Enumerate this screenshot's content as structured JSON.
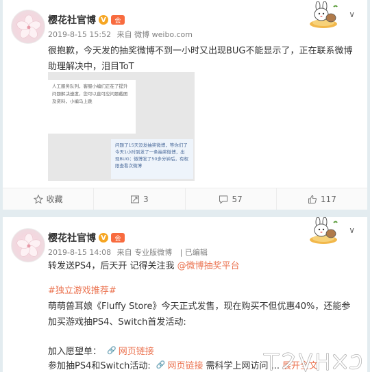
{
  "post1": {
    "author": "樱花社官博",
    "verified_badge": "V",
    "member_badge": "会",
    "date": "2019-8-15 15:52",
    "source_prefix": "来自",
    "source": "微博 weibo.com",
    "text": "很抱歉，今天发的抽奖微博不到一小时又出现BUG不能显示了，正在联系微博助理解决中，泪目ToT",
    "image": {
      "chat_left": "人工服务队列，客服小编们正在了提升问题解决速度，您可以直可应问题截图及资料，小编马上跳",
      "chat_right": "问题了15天没发抽奖微博，等你们了今天1小时到发了一条抽奖微博，出现BUG：微博发了50多分钟后，有权限查看次微博"
    },
    "actions": [
      {
        "icon": "star-icon",
        "label": "收藏"
      },
      {
        "icon": "repost-icon",
        "label": "3"
      },
      {
        "icon": "comment-icon",
        "label": "57"
      },
      {
        "icon": "thumbs-up-icon",
        "label": "117"
      }
    ]
  },
  "post2": {
    "author": "樱花社官博",
    "verified_badge": "V",
    "member_badge": "会",
    "date": "2019-8-15 14:08",
    "source_prefix": "来自",
    "source": "专业版微博",
    "edited": "已编辑",
    "line1_text": "转发送PS4，后天开 记得关注我 ",
    "line1_link": "@微博抽奖平台",
    "hashtag": "#独立游戏推荐#",
    "body": "萌萌兽耳娘《Fluffy Store》今天正式发售，现在购买不但优惠40%，还能参加买游戏抽PS4、Switch首发活动:",
    "wishlist_label": "加入愿望单：",
    "wishlist_link": "网页链接",
    "ps4_label": "参加抽PS4和Switch活动:",
    "ps4_link": "网页链接",
    "ps4_suffix": "需科学上网访问 ...",
    "expand": "展开全文",
    "chevron": "∨"
  },
  "colors": {
    "accent": "#eb7350",
    "verified": "#f6a623",
    "background": "#e3ecf0"
  }
}
